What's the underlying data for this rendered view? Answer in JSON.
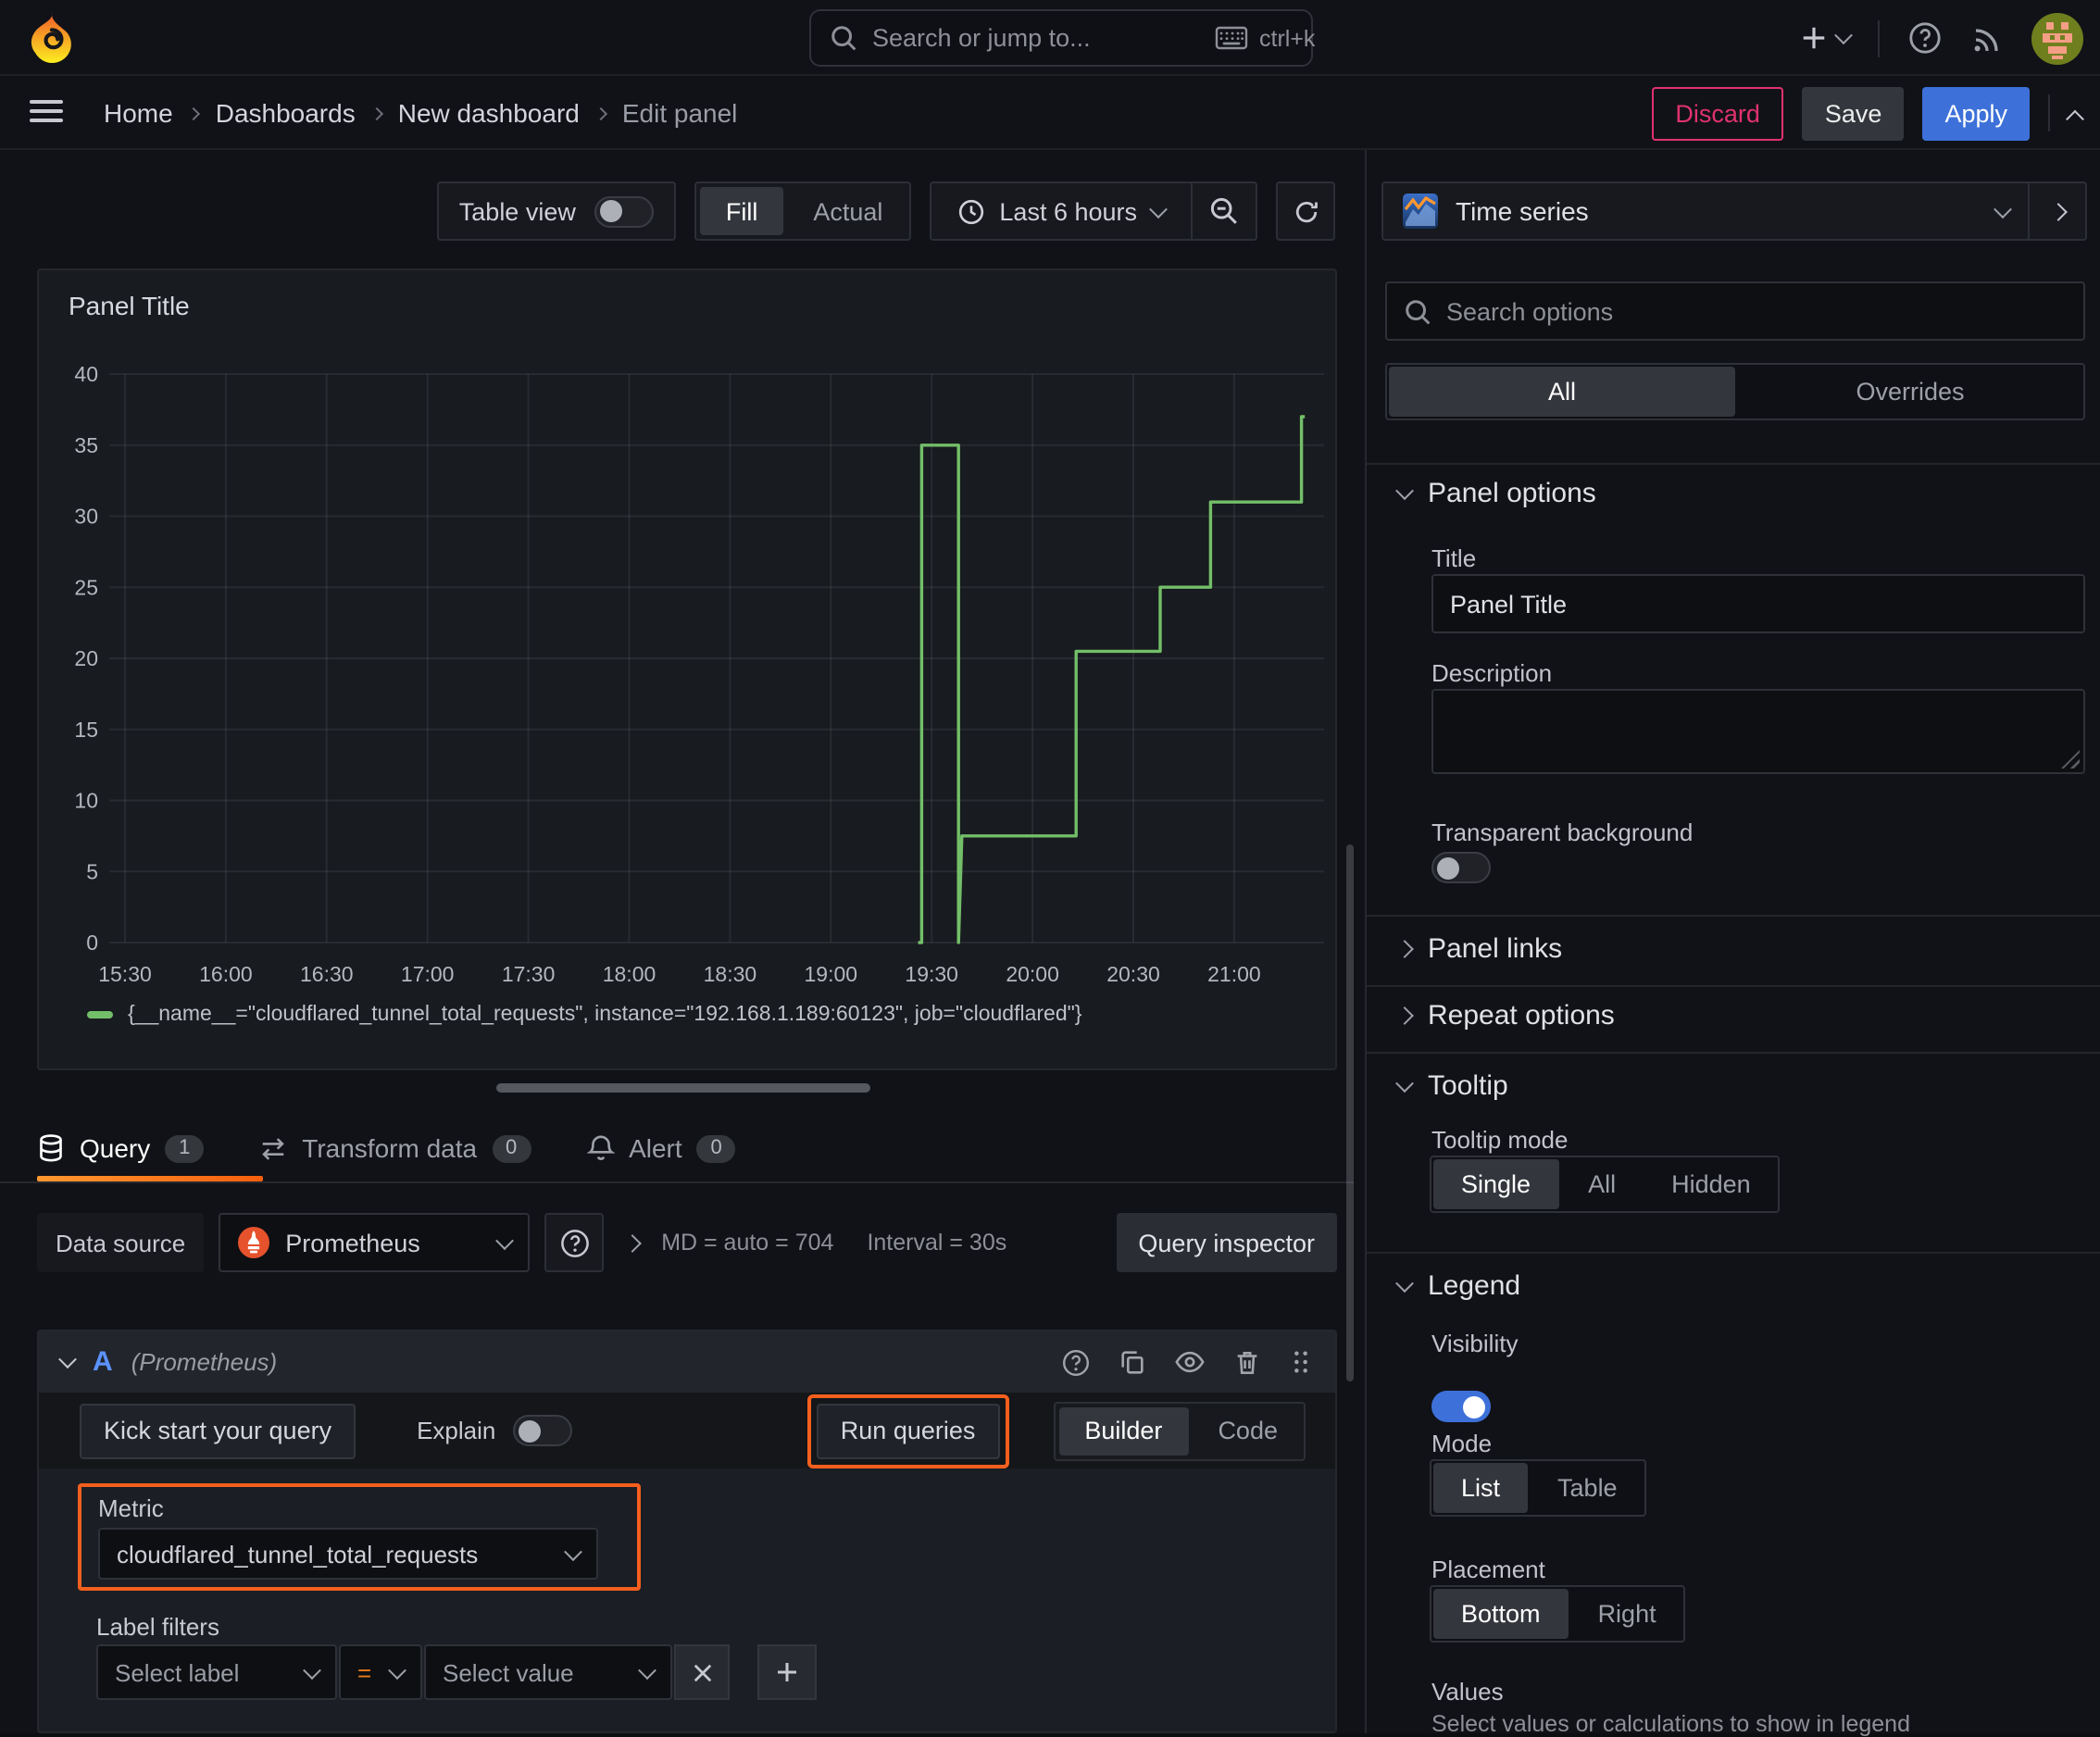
{
  "topnav": {
    "search_placeholder": "Search or jump to...",
    "shortcut": "ctrl+k"
  },
  "breadcrumb": {
    "items": [
      "Home",
      "Dashboards",
      "New dashboard",
      "Edit panel"
    ]
  },
  "actions": {
    "discard": "Discard",
    "save": "Save",
    "apply": "Apply"
  },
  "toolbar": {
    "table_view": "Table view",
    "fill": "Fill",
    "actual": "Actual",
    "time_range": "Last 6 hours"
  },
  "viz_picker": {
    "name": "Time series"
  },
  "panel": {
    "title": "Panel Title"
  },
  "chart_data": {
    "type": "line",
    "line_style": "step",
    "title": "Panel Title",
    "x_ticks": [
      "15:30",
      "16:00",
      "16:30",
      "17:00",
      "17:30",
      "18:00",
      "18:30",
      "19:00",
      "19:30",
      "20:00",
      "20:30",
      "21:00"
    ],
    "y_ticks": [
      0,
      5,
      10,
      15,
      20,
      25,
      30,
      35,
      40
    ],
    "ylim": [
      0,
      40
    ],
    "x_window": [
      "15:24",
      "21:28"
    ],
    "grid": true,
    "legend_position": "bottom",
    "series": [
      {
        "name": "{__name__=\"cloudflared_tunnel_total_requests\", instance=\"192.168.1.189:60123\", job=\"cloudflared\"}",
        "color": "#73BF69",
        "points": [
          [
            "19:26",
            0
          ],
          [
            "19:27",
            0
          ],
          [
            "19:27",
            35
          ],
          [
            "19:38",
            35
          ],
          [
            "19:38",
            0
          ],
          [
            "19:39",
            7.5
          ],
          [
            "20:13",
            7.5
          ],
          [
            "20:13",
            20.5
          ],
          [
            "20:38",
            20.5
          ],
          [
            "20:38",
            25
          ],
          [
            "20:53",
            25
          ],
          [
            "20:53",
            31
          ],
          [
            "21:20",
            31
          ],
          [
            "21:20",
            37
          ],
          [
            "21:21",
            37
          ]
        ]
      }
    ]
  },
  "tabs": {
    "query": "Query",
    "query_count": "1",
    "transform": "Transform data",
    "transform_count": "0",
    "alert": "Alert",
    "alert_count": "0"
  },
  "datasource_row": {
    "label": "Data source",
    "name": "Prometheus",
    "md_stat": "MD = auto = 704",
    "interval_stat": "Interval = 30s",
    "inspector": "Query inspector"
  },
  "query_editor": {
    "ref_id": "A",
    "ds_hint": "(Prometheus)",
    "kick_start": "Kick start your query",
    "explain": "Explain",
    "run_queries": "Run queries",
    "builder": "Builder",
    "code": "Code",
    "metric": {
      "label": "Metric",
      "value": "cloudflared_tunnel_total_requests"
    },
    "label_filters": {
      "label": "Label filters",
      "select_label": "Select label",
      "operator": "=",
      "select_value": "Select value"
    }
  },
  "options": {
    "search_placeholder": "Search options",
    "tab_all": "All",
    "tab_overrides": "Overrides",
    "panel_options": {
      "header": "Panel options",
      "title_label": "Title",
      "title_value": "Panel Title",
      "description_label": "Description",
      "transparent_label": "Transparent background"
    },
    "panel_links": "Panel links",
    "repeat_options": "Repeat options",
    "tooltip": {
      "header": "Tooltip",
      "mode_label": "Tooltip mode",
      "single": "Single",
      "all": "All",
      "hidden": "Hidden"
    },
    "legend": {
      "header": "Legend",
      "visibility_label": "Visibility",
      "mode_label": "Mode",
      "list": "List",
      "table": "Table",
      "placement_label": "Placement",
      "bottom": "Bottom",
      "right": "Right",
      "values_label": "Values",
      "values_help": "Select values or calculations to show in legend"
    }
  },
  "icons": {
    "plus": "+",
    "close": "x",
    "question": "?"
  }
}
